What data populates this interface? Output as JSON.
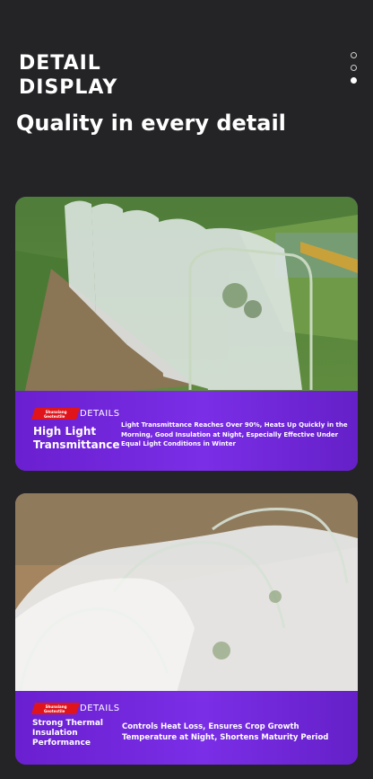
{
  "header": {
    "title": "DETAIL\nDISPLAY",
    "tagline": "Quality in every detail"
  },
  "pagination": {
    "count": 3,
    "active_index": 2
  },
  "cards": [
    {
      "badge_line1": "Shunxiang",
      "badge_line2": "Geotextile",
      "details_label": "DETAILS",
      "title": "High Light Transmittance",
      "description": "Light Transmittance Reaches Over 90%, Heats Up Quickly in the Morning, Good Insulation at Night, Especially Effective Under Equal Light Conditions in Winter"
    },
    {
      "badge_line1": "Shunxiang",
      "badge_line2": "Geotextile",
      "details_label": "DETAILS",
      "title": "Strong Thermal Insulation Performance",
      "description": "Controls Heat Loss, Ensures Crop Growth Temperature at Night, Shortens Maturity Period"
    }
  ],
  "colors": {
    "background": "#242426",
    "accent_purple": "#6f25d6",
    "badge_red": "#e0141b"
  }
}
